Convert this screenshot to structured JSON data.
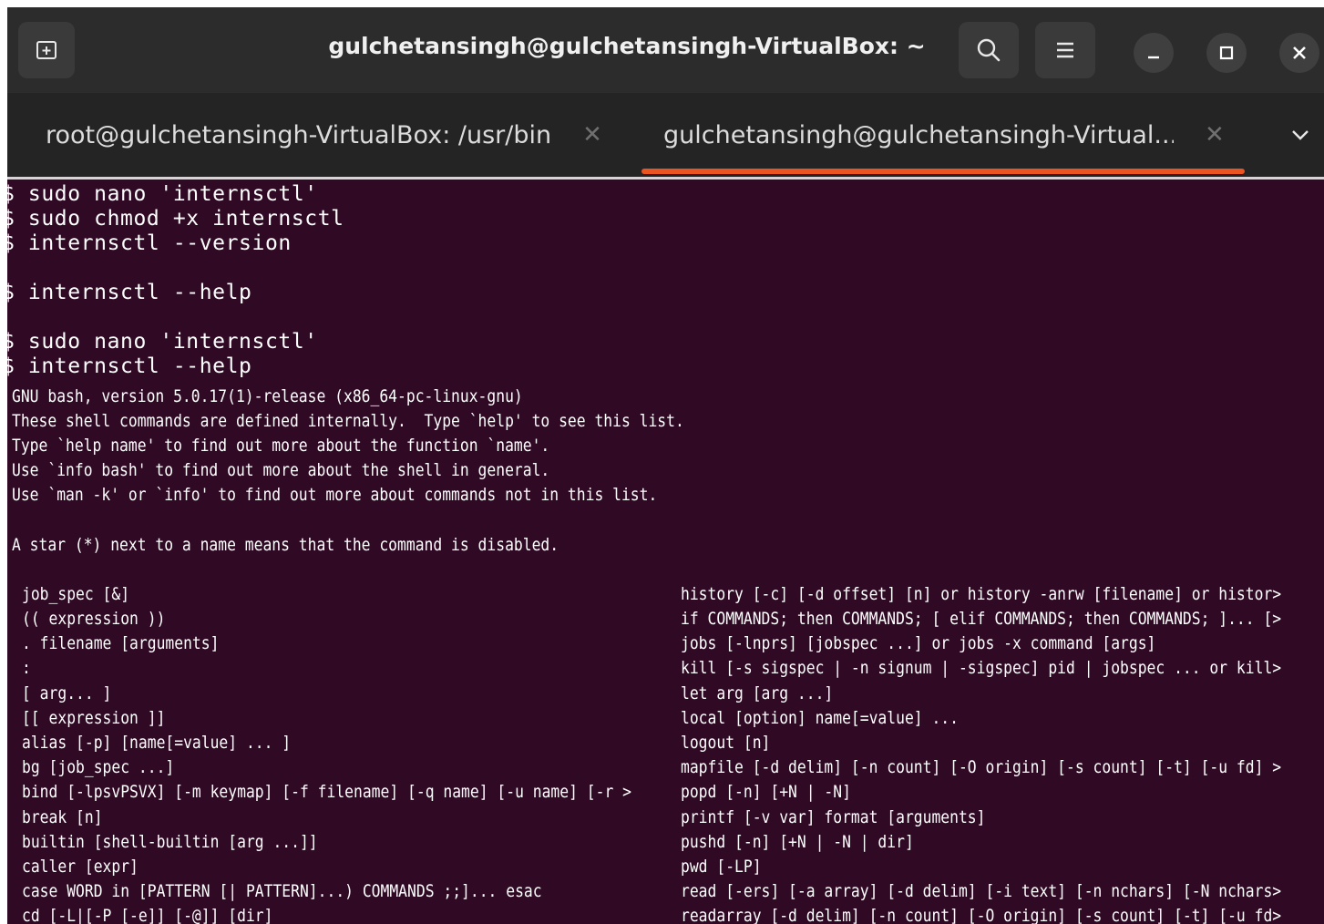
{
  "window": {
    "title": "gulchetansingh@gulchetansingh-VirtualBox: ~"
  },
  "tabs": [
    {
      "label": "root@gulchetansingh-VirtualBox: /usr/bin",
      "active": false
    },
    {
      "label": "gulchetansingh@gulchetansingh-Virtual...",
      "active": true
    }
  ],
  "icons": {
    "new_tab": "new-tab-icon",
    "search": "search-icon",
    "menu": "hamburger-menu-icon",
    "minimize": "minimize-icon",
    "maximize": "maximize-icon",
    "close": "close-icon",
    "tab_close": "tab-close-icon",
    "tabs_dropdown": "chevron-down-icon"
  },
  "colors": {
    "terminal_bg": "#300a24",
    "headerbar": "#2c2c2c",
    "tabbar": "#242424",
    "accent": "#e95420"
  },
  "terminal": {
    "commands": [
      "$ sudo nano 'internsctl'",
      "$ sudo chmod +x internsctl",
      "$ internsctl --version",
      "$ internsctl --help",
      "$ sudo nano 'internsctl'",
      "$ internsctl --help"
    ],
    "output": [
      "GNU bash, version 5.0.17(1)-release (x86_64-pc-linux-gnu)",
      "These shell commands are defined internally.  Type `help' to see this list.",
      "Type `help name' to find out more about the function `name'.",
      "Use `info bash' to find out more about the shell in general.",
      "Use `man -k' or `info' to find out more about commands not in this list.",
      "A star (*) next to a name means that the command is disabled."
    ],
    "builtins_left": [
      "job_spec [&]",
      "(( expression ))",
      ". filename [arguments]",
      ":",
      "[ arg... ]",
      "[[ expression ]]",
      "alias [-p] [name[=value] ... ]",
      "bg [job_spec ...]",
      "bind [-lpsvPSVX] [-m keymap] [-f filename] [-q name] [-u name] [-r >",
      "break [n]",
      "builtin [shell-builtin [arg ...]]",
      "caller [expr]",
      "case WORD in [PATTERN [| PATTERN]...) COMMANDS ;;]... esac",
      "cd [-L|[-P [-e]] [-@]] [dir]"
    ],
    "builtins_right": [
      "history [-c] [-d offset] [n] or history -anrw [filename] or histor>",
      "if COMMANDS; then COMMANDS; [ elif COMMANDS; then COMMANDS; ]... [>",
      "jobs [-lnprs] [jobspec ...] or jobs -x command [args]",
      "kill [-s sigspec | -n signum | -sigspec] pid | jobspec ... or kill>",
      "let arg [arg ...]",
      "local [option] name[=value] ...",
      "logout [n]",
      "mapfile [-d delim] [-n count] [-O origin] [-s count] [-t] [-u fd] >",
      "popd [-n] [+N | -N]",
      "printf [-v var] format [arguments]",
      "pushd [-n] [+N | -N | dir]",
      "pwd [-LP]",
      "read [-ers] [-a array] [-d delim] [-i text] [-n nchars] [-N nchars>",
      "readarray [-d delim] [-n count] [-O origin] [-s count] [-t] [-u fd>"
    ]
  }
}
